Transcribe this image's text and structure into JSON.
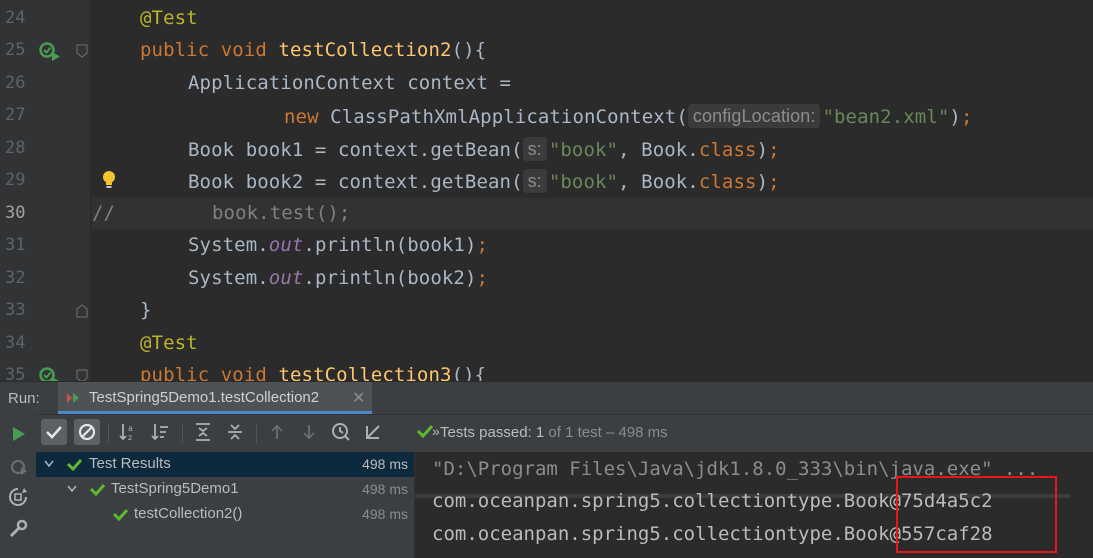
{
  "editor": {
    "line_numbers": [
      "24",
      "25",
      "26",
      "27",
      "28",
      "29",
      "30",
      "31",
      "32",
      "33",
      "34",
      "35"
    ],
    "current_line": "30",
    "lines": {
      "l24": {
        "annotation": "@Test"
      },
      "l25": {
        "kw": "public void ",
        "method": "testCollection2",
        "rest": "(){"
      },
      "l26": {
        "text": "ApplicationContext context ="
      },
      "l27": {
        "kw": "new ",
        "text": "ClassPathXmlApplicationContext(",
        "hint": "configLocation:",
        "string": "\"bean2.xml\"",
        "end": ")",
        "semi": ";"
      },
      "l28": {
        "text": "Book book1 = context.getBean(",
        "hint": "s:",
        "string": "\"book\"",
        "mid": ", Book.",
        "kw": "class",
        "end": ")",
        "semi": ";"
      },
      "l29": {
        "text": "Book book2 = context.getBean(",
        "hint": "s:",
        "string": "\"book\"",
        "mid": ", Book.",
        "kw": "class",
        "end": ")",
        "semi": ";"
      },
      "l30": {
        "comment": "//",
        "text": "book.test();"
      },
      "l31": {
        "pre": "System.",
        "field": "out",
        "text": ".println(book1)",
        "semi": ";"
      },
      "l32": {
        "pre": "System.",
        "field": "out",
        "text": ".println(book2)",
        "semi": ";"
      },
      "l33": {
        "text": "}"
      },
      "l34": {
        "annotation": "@Test"
      },
      "l35": {
        "kw": "public void ",
        "method": "testCollection3",
        "rest": "(){"
      }
    }
  },
  "run_window": {
    "label": "Run:",
    "tab_label": "TestSpring5Demo1.testCollection2",
    "more": "»",
    "status": {
      "passed": "Tests passed:",
      "count": "1",
      "detail": "of 1 test – 498 ms"
    },
    "tree": [
      {
        "label": "Test Results",
        "time": "498 ms"
      },
      {
        "label": "TestSpring5Demo1",
        "time": "498 ms"
      },
      {
        "label": "testCollection2()",
        "time": "498 ms"
      }
    ],
    "console": [
      "\"D:\\Program Files\\Java\\jdk1.8.0_333\\bin\\java.exe\" ...",
      "com.oceanpan.spring5.collectiontype.Book@75d4a5c2",
      "com.oceanpan.spring5.collectiontype.Book@557caf28"
    ]
  },
  "colors": {
    "pass_green": "#5fb832",
    "run_green": "#499c54",
    "highlight_red": "#e8161a",
    "selection_blue": "#0d293e"
  },
  "icons": [
    "run-test-gutter-icon",
    "fold-icon",
    "intention-bulb-icon",
    "rerun-icon",
    "show-passed-icon",
    "show-ignored-icon",
    "sort-alpha-icon",
    "sort-duration-icon",
    "expand-all-icon",
    "collapse-all-icon",
    "prev-failed-icon",
    "next-failed-icon",
    "test-history-icon",
    "import-tests-icon",
    "pass-check-icon",
    "tab-close-icon"
  ]
}
